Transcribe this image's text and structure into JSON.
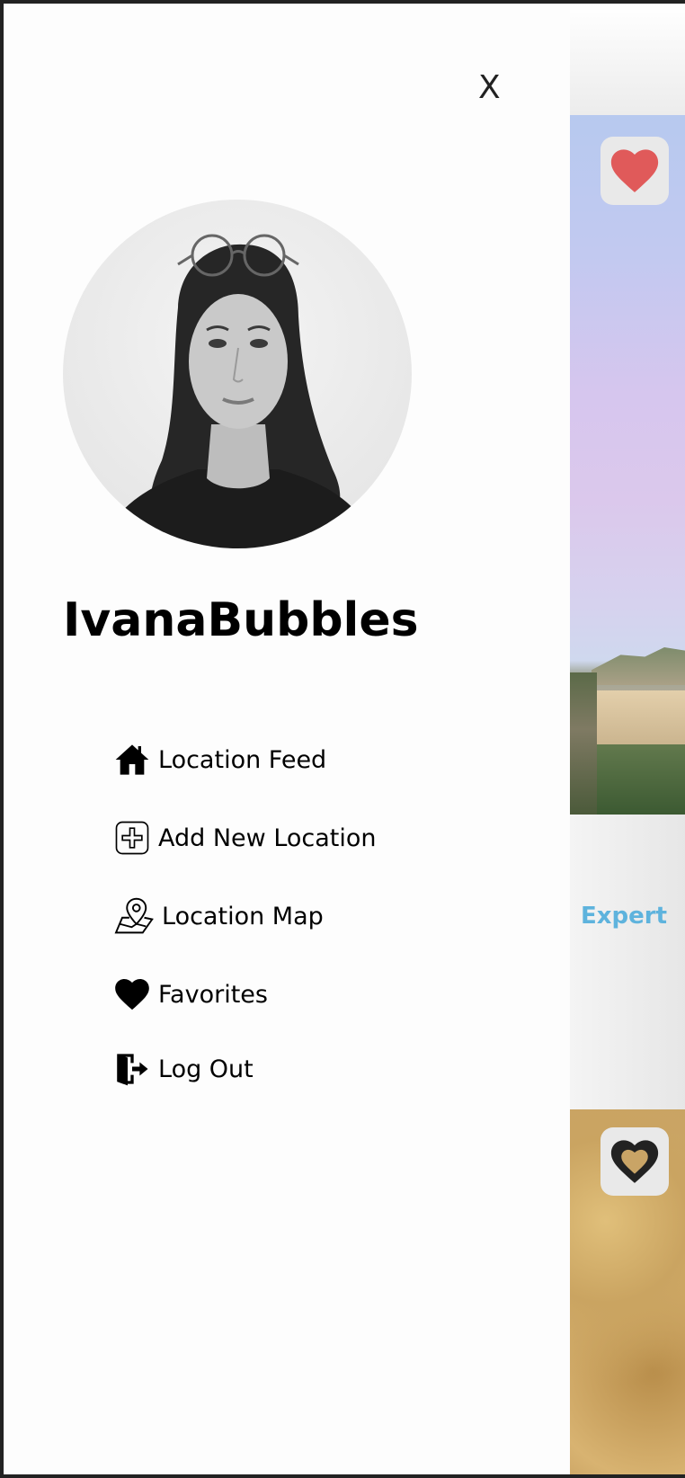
{
  "drawer": {
    "close_label": "X",
    "profile": {
      "username": "IvanaBubbles"
    },
    "menu": [
      {
        "label": "Location Feed",
        "icon": "home-icon"
      },
      {
        "label": "Add New Location",
        "icon": "plus-square-icon"
      },
      {
        "label": "Location Map",
        "icon": "map-pin-icon"
      },
      {
        "label": "Favorites",
        "icon": "heart-icon"
      },
      {
        "label": "Log Out",
        "icon": "logout-door-icon"
      }
    ]
  },
  "feed": {
    "cards": [
      {
        "favorited": true,
        "difficulty": "Expert"
      },
      {
        "favorited": false
      }
    ]
  },
  "colors": {
    "heart_filled": "#e05a5a",
    "expert_text": "#5eb3dd",
    "drawer_bg": "#fdfdfd"
  }
}
